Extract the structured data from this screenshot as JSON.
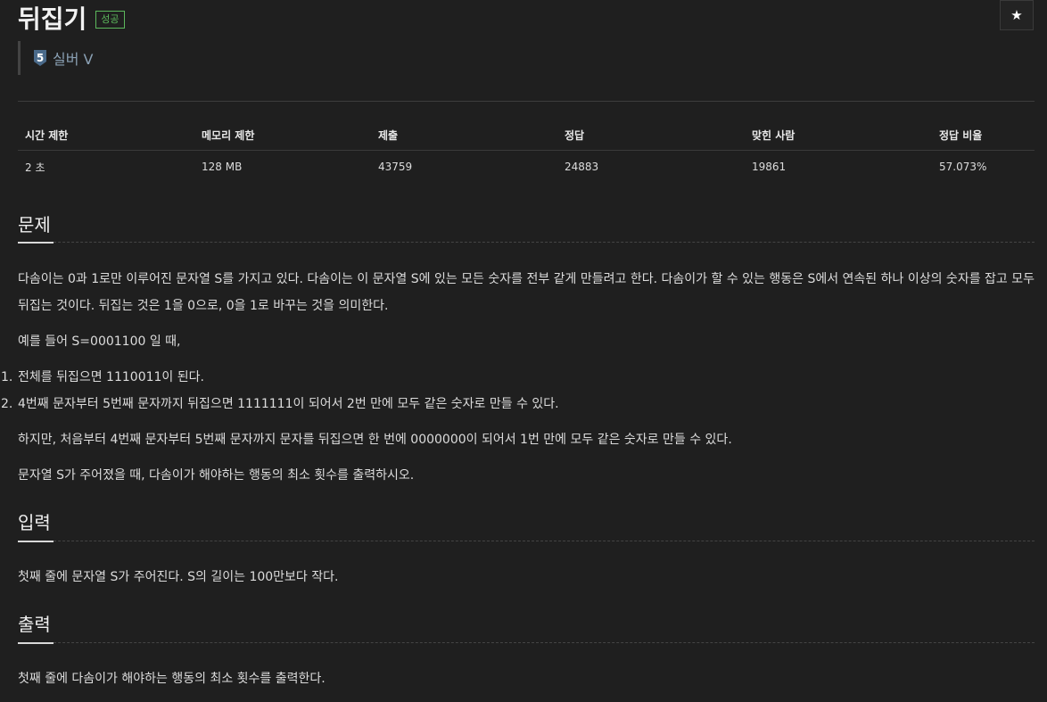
{
  "problem": {
    "title": "뒤집기",
    "status_badge": "성공",
    "star_icon": "★",
    "tier": {
      "label": "실버 V",
      "number": "5",
      "color": "#4a6a8a"
    }
  },
  "info_table": {
    "headers": [
      "시간 제한",
      "메모리 제한",
      "제출",
      "정답",
      "맞힌 사람",
      "정답 비율"
    ],
    "values": [
      "2 초",
      "128 MB",
      "43759",
      "24883",
      "19861",
      "57.073%"
    ]
  },
  "sections": {
    "description": {
      "title": "문제",
      "p1": "다솜이는 0과 1로만 이루어진 문자열 S를 가지고 있다. 다솜이는 이 문자열 S에 있는 모든 숫자를 전부 같게 만들려고 한다. 다솜이가 할 수 있는 행동은 S에서 연속된 하나 이상의 숫자를 잡고 모두 뒤집는 것이다. 뒤집는 것은 1을 0으로, 0을 1로 바꾸는 것을 의미한다.",
      "p2": "예를 들어 S=0001100 일 때,",
      "steps": [
        {
          "num": "1.",
          "text": "전체를 뒤집으면 1110011이 된다."
        },
        {
          "num": "2.",
          "text": "4번째 문자부터 5번째 문자까지 뒤집으면 1111111이 되어서 2번 만에 모두 같은 숫자로 만들 수 있다."
        }
      ],
      "p3": "하지만, 처음부터 4번째 문자부터 5번째 문자까지 문자를 뒤집으면 한 번에 0000000이 되어서 1번 만에 모두 같은 숫자로 만들 수 있다.",
      "p4": "문자열 S가 주어졌을 때, 다솜이가 해야하는 행동의 최소 횟수를 출력하시오."
    },
    "input": {
      "title": "입력",
      "text": "첫째 줄에 문자열 S가 주어진다. S의 길이는 100만보다 작다."
    },
    "output": {
      "title": "출력",
      "text": "첫째 줄에 다솜이가 해야하는 행동의 최소 횟수를 출력한다."
    }
  }
}
